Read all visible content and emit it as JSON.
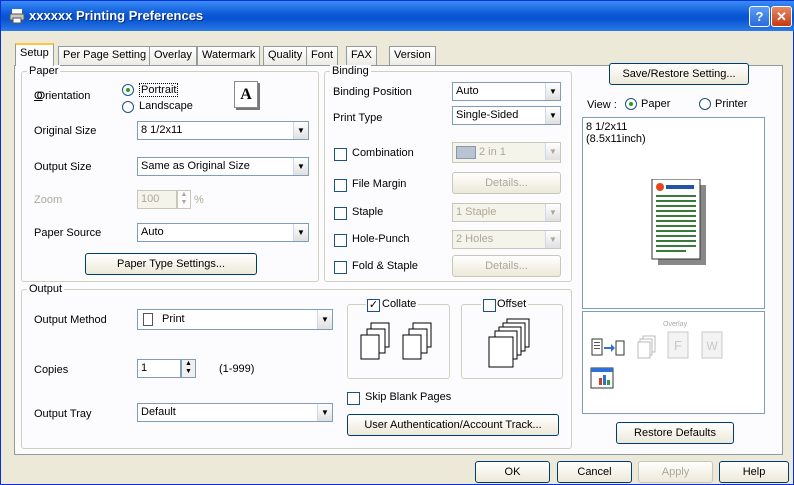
{
  "window": {
    "title": "xxxxxx Printing Preferences",
    "help_glyph": "?",
    "close_glyph": "✕"
  },
  "tabs": [
    {
      "label": "Setup"
    },
    {
      "label": "Per Page Setting"
    },
    {
      "label": "Overlay"
    },
    {
      "label": "Watermark"
    },
    {
      "label": "Quality"
    },
    {
      "label": "Font"
    },
    {
      "label": "FAX"
    },
    {
      "label": "Version"
    }
  ],
  "paper": {
    "group_label": "Paper",
    "orientation_label": "Orientation",
    "portrait_label": "Portrait",
    "landscape_label": "Landscape",
    "orientation_icon": "A",
    "original_size_label": "Original Size",
    "original_size_value": "8 1/2x11",
    "output_size_label": "Output Size",
    "output_size_value": "Same as Original Size",
    "zoom_label": "Zoom",
    "zoom_value": "100",
    "zoom_unit": "%",
    "paper_source_label": "Paper Source",
    "paper_source_value": "Auto",
    "paper_type_button": "Paper Type Settings..."
  },
  "binding": {
    "group_label": "Binding",
    "position_label": "Binding Position",
    "position_value": "Auto",
    "print_type_label": "Print Type",
    "print_type_value": "Single-Sided",
    "combination_label": "Combination",
    "combination_value": "2 in 1",
    "file_margin_label": "File Margin",
    "file_margin_button": "Details...",
    "staple_label": "Staple",
    "staple_value": "1 Staple",
    "hole_punch_label": "Hole-Punch",
    "hole_punch_value": "2 Holes",
    "fold_staple_label": "Fold & Staple",
    "fold_staple_button": "Details..."
  },
  "output": {
    "group_label": "Output",
    "method_label": "Output Method",
    "method_value": "Print",
    "copies_label": "Copies",
    "copies_value": "1",
    "copies_range": "(1-999)",
    "tray_label": "Output Tray",
    "tray_value": "Default",
    "collate_label": "Collate",
    "offset_label": "Offset",
    "skip_blank_label": "Skip Blank Pages",
    "user_auth_button": "User Authentication/Account Track..."
  },
  "preview": {
    "save_restore_button": "Save/Restore Setting...",
    "view_label": "View :",
    "paper_radio_label": "Paper",
    "printer_radio_label": "Printer",
    "paper_size_line1": "8 1/2x11",
    "paper_size_line2": "(8.5x11inch)",
    "overlay_icon_label": "Overlay",
    "restore_defaults_button": "Restore Defaults"
  },
  "footer": {
    "ok_button": "OK",
    "cancel_button": "Cancel",
    "apply_button": "Apply",
    "help_button": "Help"
  }
}
